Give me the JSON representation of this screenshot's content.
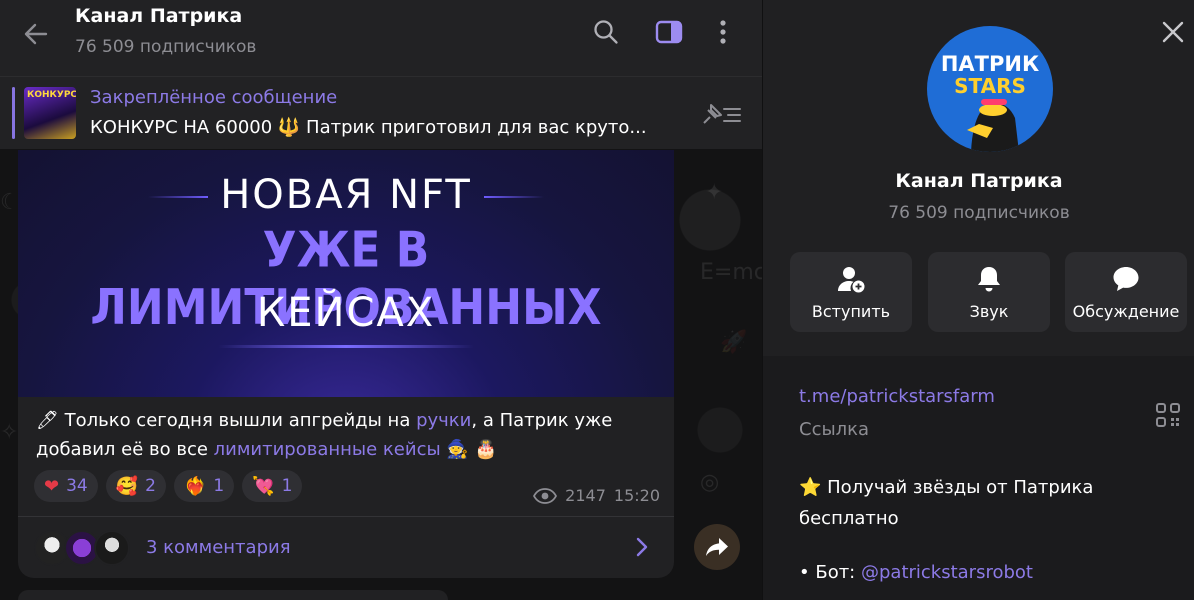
{
  "header": {
    "title": "Канал Патрика",
    "subscribers": "76 509 подписчиков"
  },
  "pinned": {
    "label": "Закреплённое сообщение",
    "text": "КОНКУРС НА 60000 🔱 Патрик приготовил для вас круто...",
    "thumb_text": "КОНКУРС"
  },
  "post": {
    "banner_line1": "НОВАЯ NFT",
    "banner_line2": "УЖЕ В ЛИМИТИРОВАННЫХ",
    "banner_line3": "КЕЙСАХ",
    "text_part1": "🖊 Только сегодня вышли апгрейды на ",
    "link1": "ручки",
    "text_part2": ", а Патрик уже добавил её во все ",
    "link2": "лимитированные кейсы",
    "text_part3": " 🧙 🎂",
    "reactions": [
      {
        "emoji": "❤",
        "count": "34",
        "color": "#e53a47"
      },
      {
        "emoji": "🥰",
        "count": "2",
        "color": "#f4a236"
      },
      {
        "emoji": "❤‍🔥",
        "count": "1",
        "color": "#e9492b"
      },
      {
        "emoji": "💘",
        "count": "1",
        "color": "#e94b8a"
      }
    ],
    "views": "2147",
    "time": "15:20",
    "comments_label": "3 комментария"
  },
  "panel": {
    "avatar_line1": "ПАТРИК",
    "avatar_line2": "STARS",
    "name": "Канал Патрика",
    "subscribers": "76 509 подписчиков",
    "actions": [
      {
        "label": "Вступить",
        "icon": "add-user-icon"
      },
      {
        "label": "Звук",
        "icon": "bell-icon"
      },
      {
        "label": "Обсуждение",
        "icon": "chat-bubble-icon"
      }
    ],
    "link": "t.me/patrickstarsfarm",
    "link_caption": "Ссылка",
    "description_line": "⭐ Получай звёзды от Патрика бесплатно",
    "bot_prefix": "• Бот: ",
    "bot_handle": "@patrickstarsrobot"
  },
  "colors": {
    "accent": "#8c7ae6",
    "panel_bg": "#1b1b1d",
    "header_bg": "#222224"
  }
}
